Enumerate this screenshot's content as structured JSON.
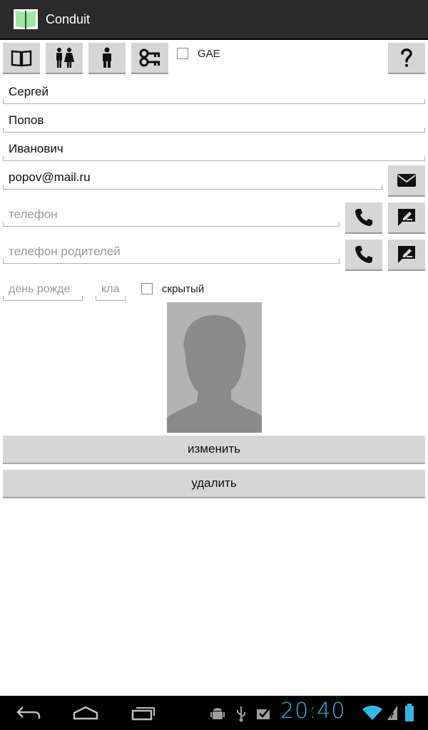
{
  "app": {
    "title": "Conduit",
    "icon": "book-icon"
  },
  "toolbar": {
    "buttons": [
      {
        "name": "book-button",
        "icon": "book-icon"
      },
      {
        "name": "people-button",
        "icon": "people-icon"
      },
      {
        "name": "person-button",
        "icon": "person-icon"
      },
      {
        "name": "keys-button",
        "icon": "keys-icon"
      }
    ],
    "gae_label": "GAE",
    "gae_checked": false,
    "help_icon": "help-icon"
  },
  "form": {
    "first_name": "Сергей",
    "last_name": "Попов",
    "patronymic": "Иванович",
    "email": "popov@mail.ru",
    "phone_placeholder": "телефон",
    "parent_phone_placeholder": "телефон родителей",
    "birthday_placeholder": "день рожде",
    "class_placeholder": "кла",
    "hidden_label": "скрытый",
    "hidden_checked": false
  },
  "actions": {
    "edit_label": "изменить",
    "delete_label": "удалить"
  },
  "statusbar": {
    "time": "20:40"
  },
  "colors": {
    "accent": "#33b5e5",
    "button_bg": "#d6d6d6",
    "actionbar": "#2a2a2a"
  }
}
